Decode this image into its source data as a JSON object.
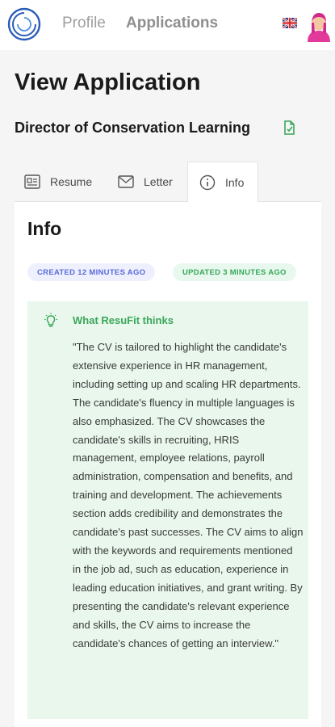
{
  "header": {
    "nav": [
      {
        "label": "Profile"
      },
      {
        "label": "Applications"
      }
    ],
    "language_icon": "uk-flag-icon",
    "avatar_icon": "user-avatar"
  },
  "page": {
    "title": "View Application",
    "job_title": "Director of Conservation Learning"
  },
  "tabs": [
    {
      "label": "Resume",
      "icon": "resume-icon"
    },
    {
      "label": "Letter",
      "icon": "envelope-icon"
    },
    {
      "label": "Info",
      "icon": "info-icon",
      "active": true
    }
  ],
  "info": {
    "heading": "Info",
    "created": "CREATED 12 MINUTES AGO",
    "updated": "UPDATED 3 MINUTES AGO",
    "thinks_title": "What ResuFit thinks",
    "thinks_text": "\"The CV is tailored to highlight the candidate's extensive experience in HR management, including setting up and scaling HR departments. The candidate's fluency in multiple languages is also emphasized. The CV showcases the candidate's skills in recruiting, HRIS management, employee relations, payroll administration, compensation and benefits, and training and development. The achievements section adds credibility and demonstrates the candidate's past successes. The CV aims to align with the keywords and requirements mentioned in the job ad, such as education, experience in leading education initiatives, and grant writing. By presenting the candidate's relevant experience and skills, the CV aims to increase the candidate's chances of getting an interview.\""
  },
  "colors": {
    "accent_blue": "#5a6bd8",
    "accent_green": "#35a85a",
    "thinks_bg": "#e9f7ec"
  }
}
